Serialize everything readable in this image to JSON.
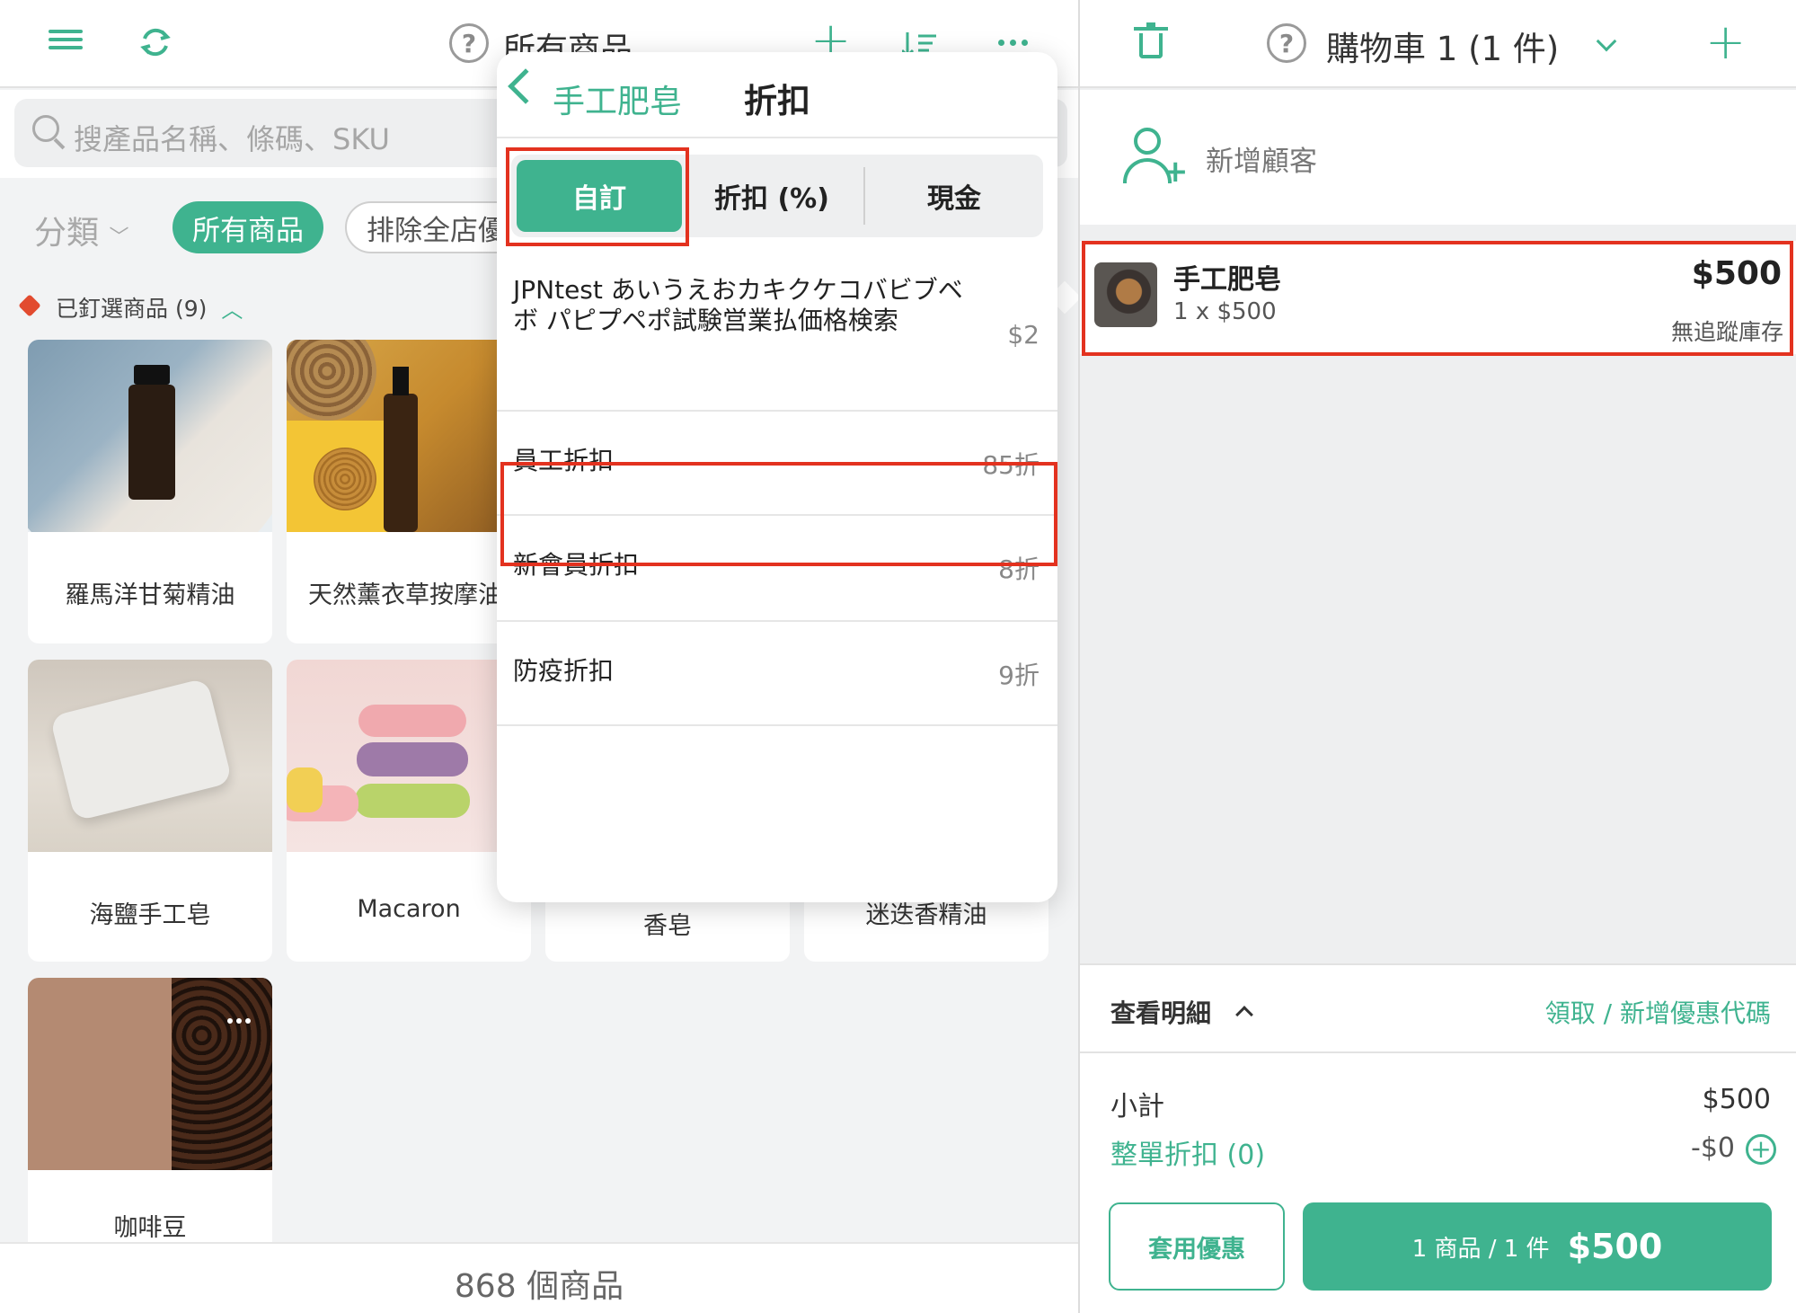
{
  "products_header": {
    "title": "所有商品",
    "search_placeholder": "搜產品名稱、條碼、SKU",
    "category_label": "分類",
    "chips": [
      "所有商品",
      "排除全店優"
    ],
    "pinned_label": "已釘選商品 (9)",
    "products": [
      {
        "name": "羅馬洋甘菊精油"
      },
      {
        "name": "天然薰衣草按摩油"
      },
      {
        "name": "海鹽手工皂"
      },
      {
        "name": "Macaron"
      },
      {
        "name": "香皂"
      },
      {
        "name": "迷迭香精油"
      },
      {
        "name": "咖啡豆"
      }
    ],
    "product_count": "868 個商品"
  },
  "discount_popover": {
    "back_label": "手工肥皂",
    "title": "折扣",
    "segments": [
      "自訂",
      "折扣 (%)",
      "現金"
    ],
    "active_segment": "自訂",
    "discounts": [
      {
        "name": "JPNtest あいうえおカキクケコバビブベボ パピプペポ試験営業払価格検索",
        "value": "$2"
      },
      {
        "name": "員工折扣",
        "value": "85折"
      },
      {
        "name": "新會員折扣",
        "value": "8折"
      },
      {
        "name": "防疫折扣",
        "value": "9折"
      }
    ]
  },
  "cart": {
    "title": "購物車 1 (1 件)",
    "add_customer": "新增顧客",
    "item": {
      "name": "手工肥皂",
      "qty": "1 x $500",
      "price": "$500",
      "stock": "無追蹤庫存"
    },
    "details_label": "查看明細",
    "coupon_link": "領取 / 新增優惠代碼",
    "subtotal_label": "小計",
    "subtotal_value": "$500",
    "order_discount_label": "整單折扣 (0)",
    "order_discount_value": "-$0",
    "apply_button": "套用優惠",
    "checkout_count": "1 商品 / 1 件",
    "checkout_total": "$500"
  },
  "colors": {
    "accent": "#3fb38f",
    "highlight": "#e3321f"
  }
}
